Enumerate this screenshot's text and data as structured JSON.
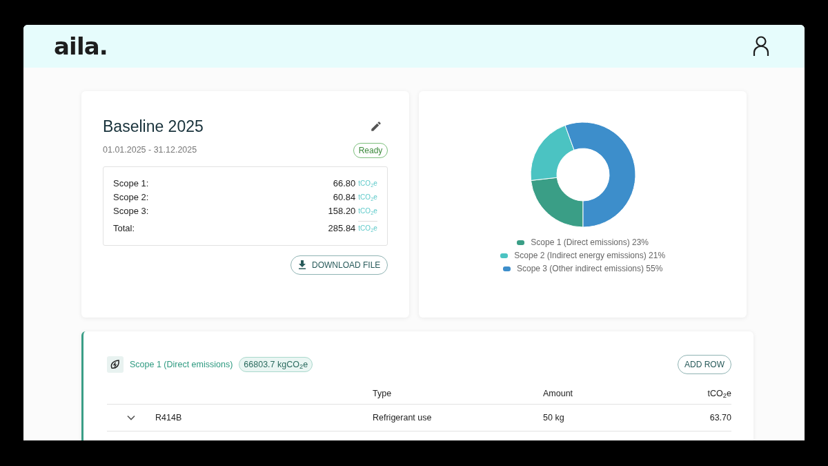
{
  "header": {
    "logo": "aila."
  },
  "baseline": {
    "title": "Baseline 2025",
    "period": "01.01.2025 - 31.12.2025",
    "status": "Ready",
    "scopes": [
      {
        "label": "Scope 1:",
        "value": "66.80",
        "unit": "tCO$_{2}$e"
      },
      {
        "label": "Scope 2:",
        "value": "60.84",
        "unit": "tCO$_{2}$e"
      },
      {
        "label": "Scope 3:",
        "value": "158.20",
        "unit": "tCO$_{2}$e"
      }
    ],
    "total": {
      "label": "Total:",
      "value": "285.84",
      "unit": "tCO$_{2}$e"
    },
    "download_button": "DOWNLOAD FILE"
  },
  "chart_data": {
    "type": "donut",
    "categories": [
      "Scope 1 (Direct emissions) 23%",
      "Scope 2 (Indirect energy emissions) 21%",
      "Scope 3 (Other indirect emissions) 55%"
    ],
    "values": [
      23,
      21,
      55
    ],
    "legend": "bottom",
    "colors": [
      "#3a9e86",
      "#4bc3c2",
      "#3d8ecb"
    ]
  },
  "scope_section": {
    "title": "Scope 1 (Direct emissions)",
    "badge": "66803.7 kgCO$_{2}$e",
    "add_button": "ADD ROW",
    "columns": [
      "Type",
      "Amount",
      "tCO$_{2}$e"
    ],
    "rows": [
      {
        "expanded": false,
        "name": "R414B",
        "type": "Refrigerant use",
        "amount": "50 kg",
        "emissions": "63.70"
      }
    ]
  }
}
